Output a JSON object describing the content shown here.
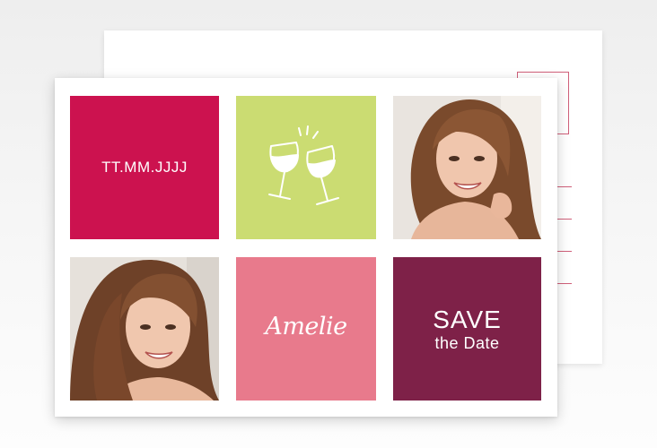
{
  "card": {
    "date_placeholder": "TT.MM.JJJJ",
    "name": "Amelie",
    "save_title": "SAVE",
    "save_subtitle": "the Date"
  },
  "colors": {
    "crimson": "#cc124f",
    "lime": "#cbdc72",
    "pink": "#e87a8c",
    "plum": "#7e2148",
    "line_accent": "#d0607a"
  },
  "icons": {
    "toast": "wine-glasses-icon"
  }
}
